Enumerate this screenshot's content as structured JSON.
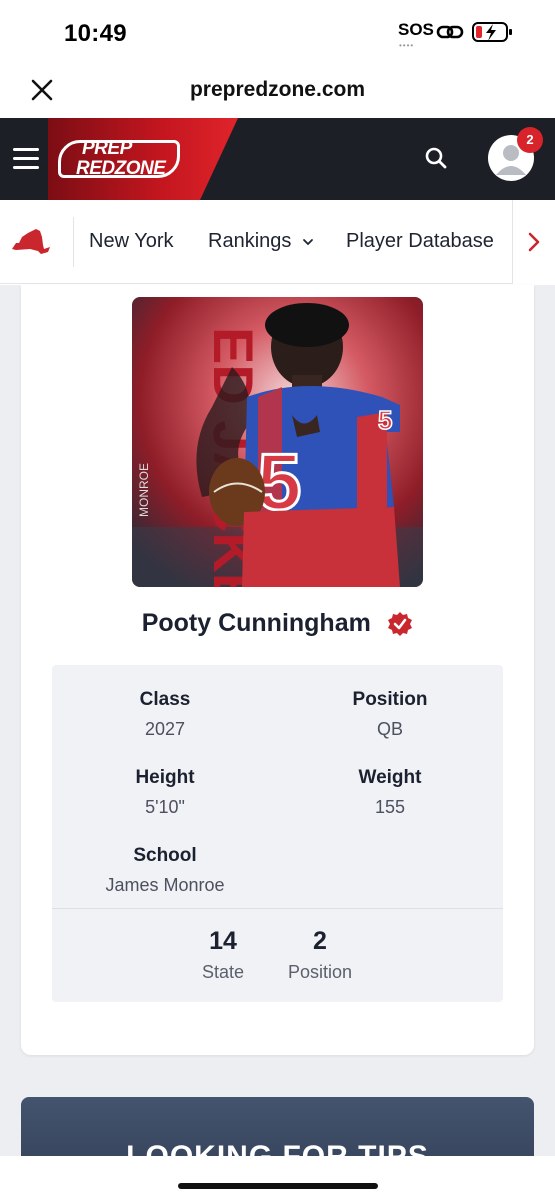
{
  "status_bar": {
    "time": "10:49",
    "sos": "SOS",
    "sos_dots": "••••"
  },
  "url_bar": {
    "url": "prepredzone.com"
  },
  "header": {
    "logo_line1": "PREP",
    "logo_line2": "REDZONE",
    "notification_count": "2"
  },
  "nav": {
    "items": [
      {
        "label": "New York"
      },
      {
        "label": "Rankings"
      },
      {
        "label": "Player Database"
      }
    ]
  },
  "player": {
    "name": "Pooty Cunningham",
    "jersey_number": "5",
    "photo_side_text": "ED JACKETS",
    "photo_school_text": "MONROE",
    "fields": [
      {
        "label": "Class",
        "value": "2027"
      },
      {
        "label": "Position",
        "value": "QB"
      },
      {
        "label": "Height",
        "value": "5'10\""
      },
      {
        "label": "Weight",
        "value": "155"
      },
      {
        "label": "School",
        "value": "James Monroe"
      }
    ],
    "rankings": [
      {
        "number": "14",
        "label": "State"
      },
      {
        "number": "2",
        "label": "Position"
      }
    ]
  },
  "promo": {
    "text": "LOOKING FOR TIPS"
  },
  "colors": {
    "brand_red": "#d8232a",
    "header_dark": "#1d1f27",
    "text_dark": "#1b2130"
  }
}
